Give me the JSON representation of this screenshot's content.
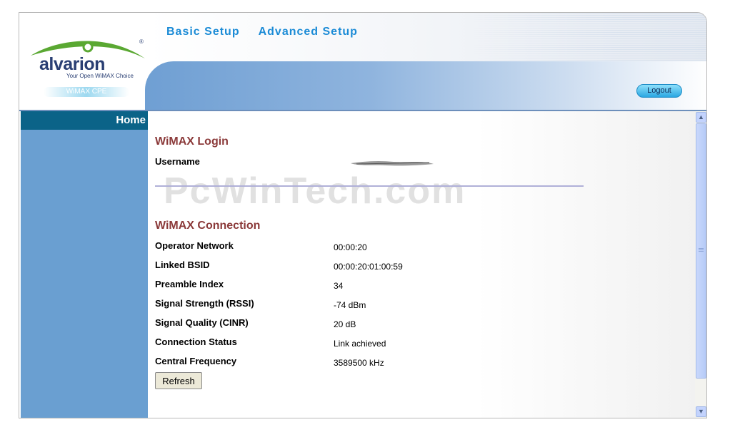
{
  "brand": {
    "logo_text": "alvarion",
    "tagline": "Your Open WiMAX Choice",
    "badge": "WiMAX CPE",
    "registered": "®"
  },
  "nav": {
    "basic_setup": "Basic Setup",
    "advanced_setup": "Advanced Setup"
  },
  "header": {
    "logout_label": "Logout"
  },
  "sidebar": {
    "home_label": "Home"
  },
  "watermark": "PcWinTech.com",
  "login": {
    "title": "WiMAX Login",
    "username_label": "Username",
    "username_value": "redacted (scribbled)"
  },
  "connection": {
    "title": "WiMAX Connection",
    "rows": [
      {
        "label": "Operator Network",
        "value": "00:00:20"
      },
      {
        "label": "Linked BSID",
        "value": "00:00:20:01:00:59"
      },
      {
        "label": "Preamble Index",
        "value": "34"
      },
      {
        "label": "Signal Strength (RSSI)",
        "value": "-74 dBm"
      },
      {
        "label": "Signal Quality (CINR)",
        "value": "20 dB"
      },
      {
        "label": "Connection Status",
        "value": "Link achieved"
      },
      {
        "label": "Central Frequency",
        "value": "3589500 kHz"
      }
    ],
    "refresh_label": "Refresh"
  },
  "colors": {
    "nav_link": "#1b8bd6",
    "section_title": "#8b3a3a",
    "sidebar": "#6a9fd1",
    "home_bar": "#0b6388"
  }
}
